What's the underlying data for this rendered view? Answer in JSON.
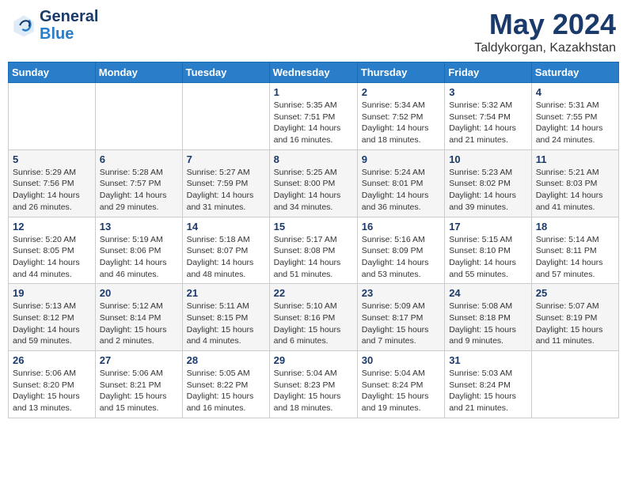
{
  "logo": {
    "line1": "General",
    "line2": "Blue"
  },
  "title": "May 2024",
  "location": "Taldykorgan, Kazakhstan",
  "weekdays": [
    "Sunday",
    "Monday",
    "Tuesday",
    "Wednesday",
    "Thursday",
    "Friday",
    "Saturday"
  ],
  "weeks": [
    [
      {
        "day": "",
        "info": ""
      },
      {
        "day": "",
        "info": ""
      },
      {
        "day": "",
        "info": ""
      },
      {
        "day": "1",
        "info": "Sunrise: 5:35 AM\nSunset: 7:51 PM\nDaylight: 14 hours\nand 16 minutes."
      },
      {
        "day": "2",
        "info": "Sunrise: 5:34 AM\nSunset: 7:52 PM\nDaylight: 14 hours\nand 18 minutes."
      },
      {
        "day": "3",
        "info": "Sunrise: 5:32 AM\nSunset: 7:54 PM\nDaylight: 14 hours\nand 21 minutes."
      },
      {
        "day": "4",
        "info": "Sunrise: 5:31 AM\nSunset: 7:55 PM\nDaylight: 14 hours\nand 24 minutes."
      }
    ],
    [
      {
        "day": "5",
        "info": "Sunrise: 5:29 AM\nSunset: 7:56 PM\nDaylight: 14 hours\nand 26 minutes."
      },
      {
        "day": "6",
        "info": "Sunrise: 5:28 AM\nSunset: 7:57 PM\nDaylight: 14 hours\nand 29 minutes."
      },
      {
        "day": "7",
        "info": "Sunrise: 5:27 AM\nSunset: 7:59 PM\nDaylight: 14 hours\nand 31 minutes."
      },
      {
        "day": "8",
        "info": "Sunrise: 5:25 AM\nSunset: 8:00 PM\nDaylight: 14 hours\nand 34 minutes."
      },
      {
        "day": "9",
        "info": "Sunrise: 5:24 AM\nSunset: 8:01 PM\nDaylight: 14 hours\nand 36 minutes."
      },
      {
        "day": "10",
        "info": "Sunrise: 5:23 AM\nSunset: 8:02 PM\nDaylight: 14 hours\nand 39 minutes."
      },
      {
        "day": "11",
        "info": "Sunrise: 5:21 AM\nSunset: 8:03 PM\nDaylight: 14 hours\nand 41 minutes."
      }
    ],
    [
      {
        "day": "12",
        "info": "Sunrise: 5:20 AM\nSunset: 8:05 PM\nDaylight: 14 hours\nand 44 minutes."
      },
      {
        "day": "13",
        "info": "Sunrise: 5:19 AM\nSunset: 8:06 PM\nDaylight: 14 hours\nand 46 minutes."
      },
      {
        "day": "14",
        "info": "Sunrise: 5:18 AM\nSunset: 8:07 PM\nDaylight: 14 hours\nand 48 minutes."
      },
      {
        "day": "15",
        "info": "Sunrise: 5:17 AM\nSunset: 8:08 PM\nDaylight: 14 hours\nand 51 minutes."
      },
      {
        "day": "16",
        "info": "Sunrise: 5:16 AM\nSunset: 8:09 PM\nDaylight: 14 hours\nand 53 minutes."
      },
      {
        "day": "17",
        "info": "Sunrise: 5:15 AM\nSunset: 8:10 PM\nDaylight: 14 hours\nand 55 minutes."
      },
      {
        "day": "18",
        "info": "Sunrise: 5:14 AM\nSunset: 8:11 PM\nDaylight: 14 hours\nand 57 minutes."
      }
    ],
    [
      {
        "day": "19",
        "info": "Sunrise: 5:13 AM\nSunset: 8:12 PM\nDaylight: 14 hours\nand 59 minutes."
      },
      {
        "day": "20",
        "info": "Sunrise: 5:12 AM\nSunset: 8:14 PM\nDaylight: 15 hours\nand 2 minutes."
      },
      {
        "day": "21",
        "info": "Sunrise: 5:11 AM\nSunset: 8:15 PM\nDaylight: 15 hours\nand 4 minutes."
      },
      {
        "day": "22",
        "info": "Sunrise: 5:10 AM\nSunset: 8:16 PM\nDaylight: 15 hours\nand 6 minutes."
      },
      {
        "day": "23",
        "info": "Sunrise: 5:09 AM\nSunset: 8:17 PM\nDaylight: 15 hours\nand 7 minutes."
      },
      {
        "day": "24",
        "info": "Sunrise: 5:08 AM\nSunset: 8:18 PM\nDaylight: 15 hours\nand 9 minutes."
      },
      {
        "day": "25",
        "info": "Sunrise: 5:07 AM\nSunset: 8:19 PM\nDaylight: 15 hours\nand 11 minutes."
      }
    ],
    [
      {
        "day": "26",
        "info": "Sunrise: 5:06 AM\nSunset: 8:20 PM\nDaylight: 15 hours\nand 13 minutes."
      },
      {
        "day": "27",
        "info": "Sunrise: 5:06 AM\nSunset: 8:21 PM\nDaylight: 15 hours\nand 15 minutes."
      },
      {
        "day": "28",
        "info": "Sunrise: 5:05 AM\nSunset: 8:22 PM\nDaylight: 15 hours\nand 16 minutes."
      },
      {
        "day": "29",
        "info": "Sunrise: 5:04 AM\nSunset: 8:23 PM\nDaylight: 15 hours\nand 18 minutes."
      },
      {
        "day": "30",
        "info": "Sunrise: 5:04 AM\nSunset: 8:24 PM\nDaylight: 15 hours\nand 19 minutes."
      },
      {
        "day": "31",
        "info": "Sunrise: 5:03 AM\nSunset: 8:24 PM\nDaylight: 15 hours\nand 21 minutes."
      },
      {
        "day": "",
        "info": ""
      }
    ]
  ]
}
